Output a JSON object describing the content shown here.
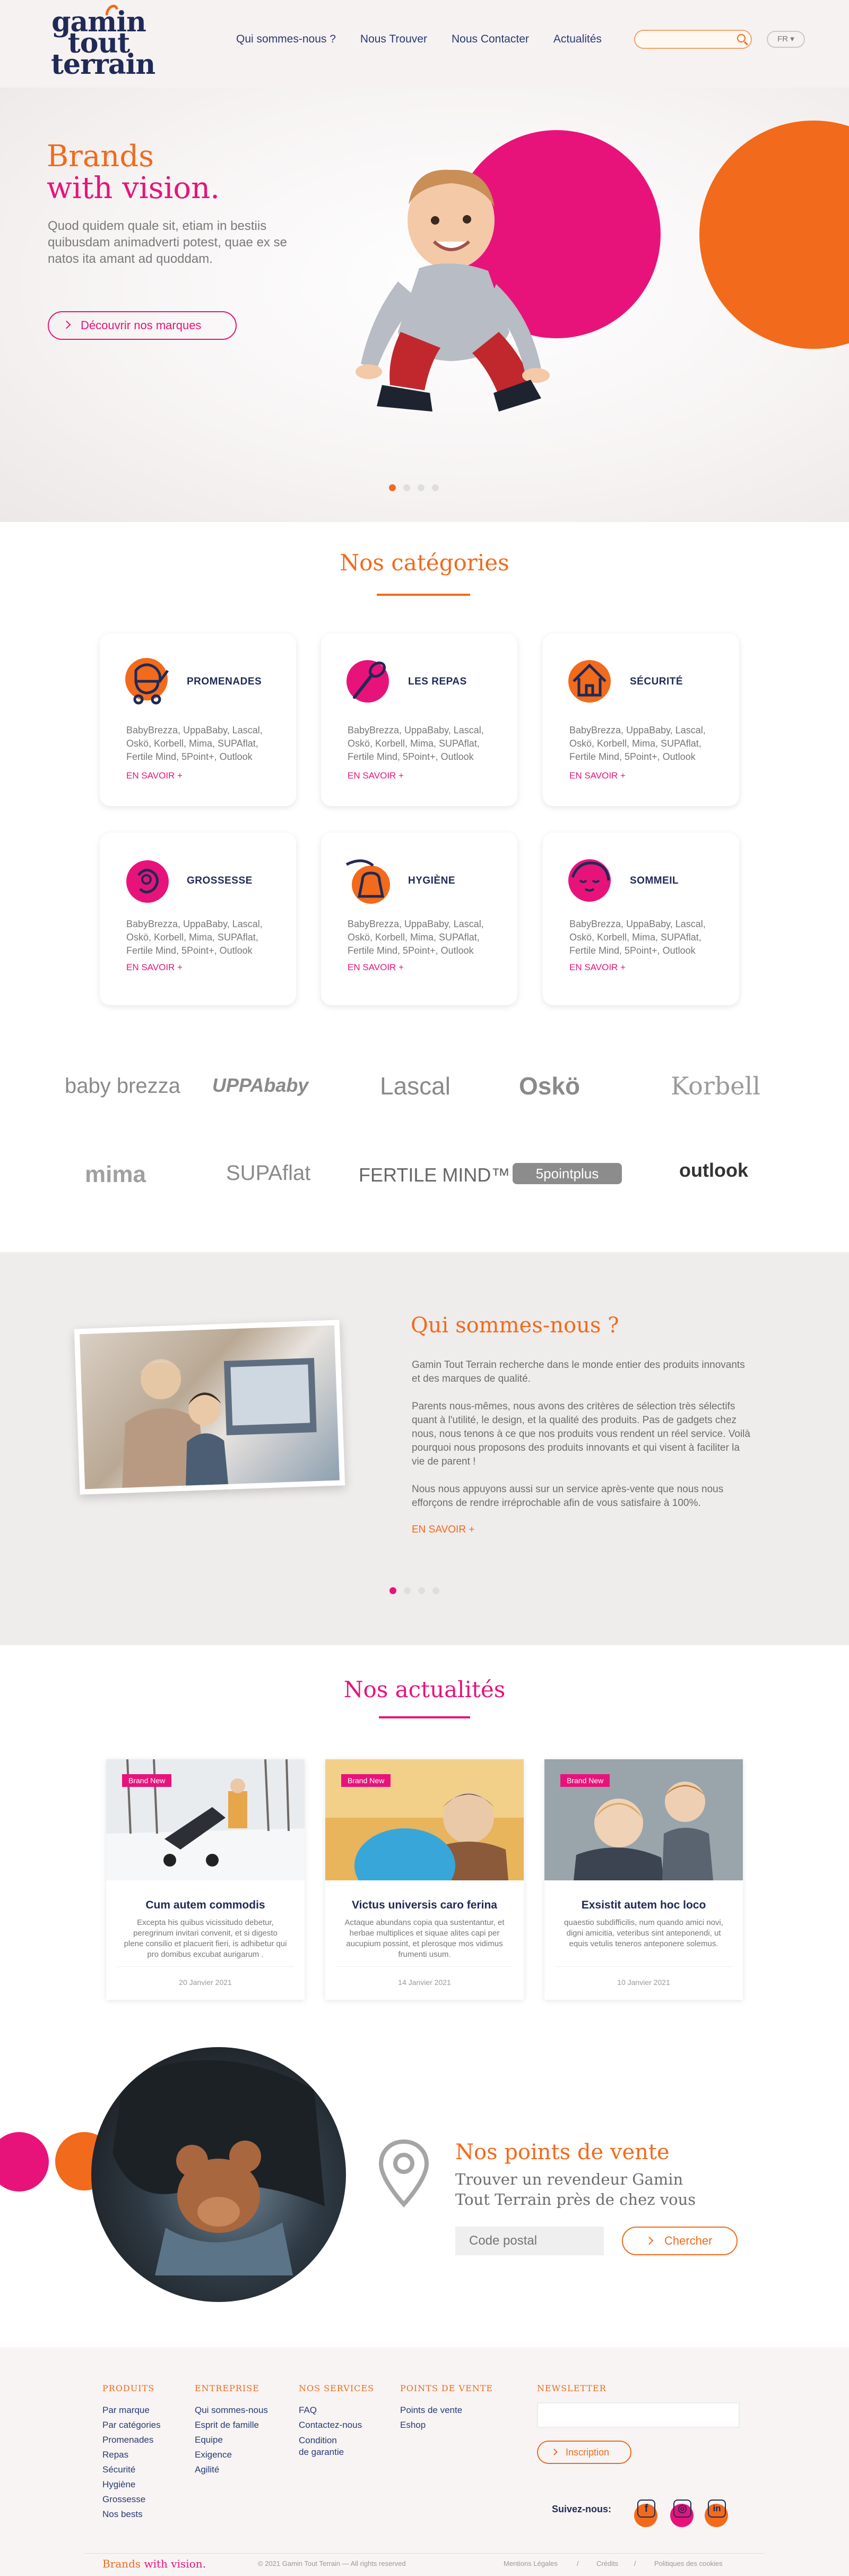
{
  "header": {
    "logo": [
      "gamin",
      "tout",
      "terrain"
    ],
    "nav": [
      "Qui sommes-nous ?",
      "Nous Trouver",
      "Nous Contacter",
      "Actualités"
    ],
    "search_placeholder": "",
    "lang": "FR"
  },
  "hero": {
    "title_line1": "Brands",
    "title_line2": "with vision.",
    "text": "Quod quidem quale sit, etiam in bestiis quibusdam animadverti potest, quae ex se natos ita amant ad quoddam.",
    "button": "Découvrir nos marques",
    "colors": {
      "pink": "#e8137a",
      "orange": "#f26a1b",
      "navy": "#1f2a56"
    }
  },
  "categories": {
    "title": "Nos catégories",
    "items": [
      {
        "name": "PROMENADES",
        "icon": "stroller-icon",
        "color": "#f26a1b",
        "desc": "BabyBrezza, UppaBaby, Lascal, Oskö, Korbell, Mima, SUPAflat, Fertile Mind, 5Point+, Outlook",
        "more": "EN SAVOIR +"
      },
      {
        "name": "LES REPAS",
        "icon": "spoon-icon",
        "color": "#e8137a",
        "desc": "BabyBrezza, UppaBaby, Lascal, Oskö, Korbell, Mima, SUPAflat, Fertile Mind, 5Point+, Outlook",
        "more": "EN SAVOIR +"
      },
      {
        "name": "SÉCURITÉ",
        "icon": "house-icon",
        "color": "#f26a1b",
        "desc": "BabyBrezza, UppaBaby, Lascal, Oskö, Korbell, Mima, SUPAflat, Fertile Mind, 5Point+, Outlook",
        "more": "EN SAVOIR +"
      },
      {
        "name": "GROSSESSE",
        "icon": "pregnancy-icon",
        "color": "#e8137a",
        "desc": "BabyBrezza, UppaBaby, Lascal, Oskö, Korbell, Mima, SUPAflat, Fertile Mind, 5Point+, Outlook",
        "more": "EN SAVOIR +"
      },
      {
        "name": "HYGIÈNE",
        "icon": "bath-icon",
        "color": "#f26a1b",
        "desc": "BabyBrezza, UppaBaby, Lascal, Oskö, Korbell, Mima, SUPAflat, Fertile Mind, 5Point+, Outlook",
        "more": "EN SAVOIR +"
      },
      {
        "name": "SOMMEIL",
        "icon": "sleeping-baby-icon",
        "color": "#e8137a",
        "desc": "BabyBrezza, UppaBaby, Lascal, Oskö, Korbell, Mima, SUPAflat, Fertile Mind, 5Point+, Outlook",
        "more": "EN SAVOIR +"
      }
    ]
  },
  "brands": [
    "baby brezza",
    "UPPAbaby",
    "Lascal",
    "Oskö",
    "Korbell",
    "mima",
    "SUPAflat",
    "FERTILE MIND™",
    "5pointplus",
    "outlook"
  ],
  "about": {
    "title": "Qui sommes-nous ?",
    "p1": "Gamin Tout Terrain recherche dans le monde entier des produits innovants et des marques de qualité.",
    "p2": "Parents nous-mêmes, nous avons des critères de sélection très sélectifs quant à l'utilité, le design, et la qualité des produits. Pas de gadgets chez nous, nous tenons à ce que nos produits vous rendent un réel service. Voilà pourquoi nous proposons des produits innovants et qui visent à faciliter la vie de parent !",
    "p3": "Nous nous appuyons aussi sur un service après-vente que nous nous efforçons de rendre irréprochable afin de vous satisfaire à 100%.",
    "more": "EN SAVOIR +"
  },
  "news": {
    "title": "Nos actualités",
    "items": [
      {
        "badge": "Brand New",
        "title": "Cum autem commodis",
        "text": "Excepta his quibus vicissitudo debetur, peregrinum invitari convenit, et si digesto plene consilio et placuerit fieri, is adhibetur qui pro domibus excubat aurigarum .",
        "date": "20 Janvier 2021"
      },
      {
        "badge": "Brand New",
        "title": "Victus universis caro ferina",
        "text": "Actaque abundans copia qua sustentantur, et herbae multiplices et siquae alites capi per aucupium possint, et plerosque mos vidimus frumenti usum.",
        "date": "14 Janvier 2021"
      },
      {
        "badge": "Brand New",
        "title": "Exsistit autem hoc loco",
        "text": "quaestio subdifficilis, num quando amici novi, digni amicitia, veteribus sint anteponendi, ut equis vetulis teneros anteponere solemus.",
        "date": "10 Janvier 2021"
      }
    ]
  },
  "stores": {
    "title": "Nos points de vente",
    "subtitle": "Trouver un revendeur Gamin Tout Terrain près de chez vous",
    "placeholder": "Code postal",
    "button": "Chercher"
  },
  "footer": {
    "cols": [
      {
        "h": "PRODUITS",
        "links": [
          "Par marque",
          "Par catégories",
          "Promenades",
          "Repas",
          "Sécurité",
          "Hygiène",
          "Grossesse",
          "Nos bests"
        ]
      },
      {
        "h": "ENTREPRISE",
        "links": [
          "Qui sommes-nous",
          "Esprit de famille",
          "Equipe",
          "Exigence",
          "Agilité"
        ]
      },
      {
        "h": "NOS SERVICES",
        "links": [
          "FAQ",
          "Contactez-nous",
          "Condition",
          "de garantie"
        ]
      },
      {
        "h": "POINTS DE VENTE",
        "links": [
          "Points de vente",
          "Eshop"
        ]
      }
    ],
    "newsletter": "NEWSLETTER",
    "inscription": "Inscription",
    "follow": "Suivez-nous:",
    "brand1": "Brands",
    "brand2": "with vision.",
    "copyright": "© 2021 Gamin Tout Terrain — All rights reserved",
    "legal": [
      "Mentions Légales",
      "/",
      "Crédits",
      "/",
      "Politiques des cookies"
    ]
  }
}
